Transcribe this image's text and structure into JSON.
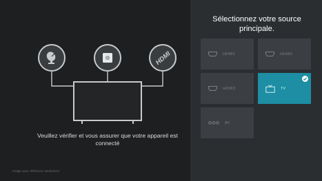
{
  "info": {
    "message": "Veuillez vérifier et vous assurer que votre appareil est connecté",
    "footnote": "Image pour référence seulement"
  },
  "illustration": {
    "icons": [
      "satellite-dish-icon",
      "set-top-box-icon",
      "hdmi-icon"
    ],
    "hdmi_glyph": "HDMI"
  },
  "sources": {
    "title": "Sélectionnez votre source principale.",
    "tiles": [
      {
        "label": "HDMI1",
        "icon": "hdmi-port-icon"
      },
      {
        "label": "HDMI2",
        "icon": "hdmi-port-icon"
      },
      {
        "label": "HDMI3",
        "icon": "hdmi-port-icon"
      },
      {
        "label": "TV",
        "icon": "tv-icon",
        "selected": true
      },
      {
        "label": "AV",
        "icon": "av-jacks-icon"
      }
    ]
  },
  "colors": {
    "accent": "#1d8ea3",
    "tile": "#3b3e42",
    "panel": "#2b2e31",
    "background": "#1d1f21"
  }
}
